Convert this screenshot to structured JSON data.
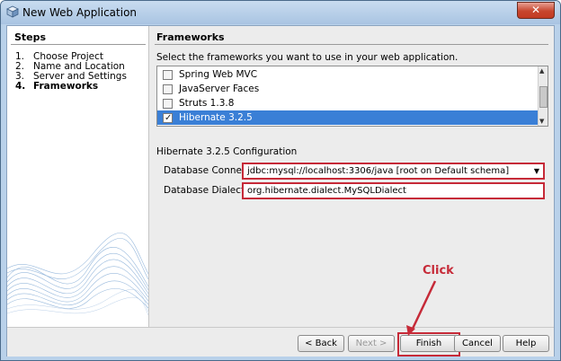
{
  "window": {
    "title": "New Web Application",
    "close_label": "✕"
  },
  "steps": {
    "heading": "Steps",
    "items": [
      {
        "num": "1.",
        "label": "Choose Project",
        "active": false
      },
      {
        "num": "2.",
        "label": "Name and Location",
        "active": false
      },
      {
        "num": "3.",
        "label": "Server and Settings",
        "active": false
      },
      {
        "num": "4.",
        "label": "Frameworks",
        "active": true
      }
    ]
  },
  "main": {
    "heading": "Frameworks",
    "instructions": "Select the frameworks you want to use in your web application.",
    "frameworks": [
      {
        "label": "Spring Web MVC",
        "checked": false,
        "selected": false
      },
      {
        "label": "JavaServer Faces",
        "checked": false,
        "selected": false
      },
      {
        "label": "Struts 1.3.8",
        "checked": false,
        "selected": false
      },
      {
        "label": "Hibernate 3.2.5",
        "checked": true,
        "selected": true
      }
    ],
    "config_title": "Hibernate 3.2.5 Configuration",
    "db_connection_label": "Database Connection:",
    "db_connection_value": "jdbc:mysql://localhost:3306/java [root on Default schema]",
    "db_dialect_label": "Database Dialect:",
    "db_dialect_value": "org.hibernate.dialect.MySQLDialect"
  },
  "annotation": {
    "text": "Click",
    "color": "#c62a38"
  },
  "buttons": {
    "back": "< Back",
    "next": "Next >",
    "finish": "Finish",
    "cancel": "Cancel",
    "help": "Help"
  },
  "colors": {
    "selection": "#3a7fd6",
    "highlight_border": "#c62a38",
    "titlebar": "#b9d1ea"
  }
}
